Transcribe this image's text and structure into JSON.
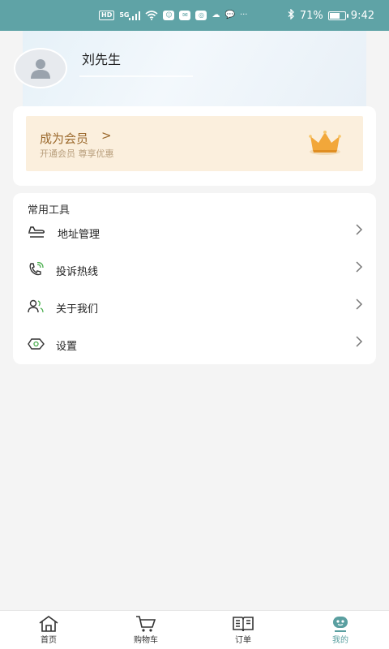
{
  "status_bar": {
    "hd": "HD",
    "signal": "5G",
    "battery": "71%",
    "battery_level": 0.71,
    "time": "9:42",
    "more": "···"
  },
  "profile": {
    "name": "刘先生"
  },
  "member": {
    "title": "成为会员",
    "arrow": ">",
    "subtitle": "开通会员 尊享优惠",
    "accent": "#9c6a2e",
    "banner_color": "#fbefdd"
  },
  "tools": {
    "title": "常用工具",
    "items": [
      {
        "label": "地址管理",
        "icon": "airplane-icon"
      },
      {
        "label": "投诉热线",
        "icon": "phone-icon"
      },
      {
        "label": "关于我们",
        "icon": "users-icon"
      },
      {
        "label": "设置",
        "icon": "settings-icon"
      }
    ]
  },
  "tabbar": {
    "tabs": [
      {
        "label": "首页",
        "icon": "home-icon",
        "active": false
      },
      {
        "label": "购物车",
        "icon": "cart-icon",
        "active": false
      },
      {
        "label": "订单",
        "icon": "book-icon",
        "active": false
      },
      {
        "label": "我的",
        "icon": "profile-face-icon",
        "active": true
      }
    ],
    "active_color": "#5a9fa0"
  },
  "colors": {
    "status_bar": "#5fa3a6",
    "background": "#f4f4f4"
  }
}
